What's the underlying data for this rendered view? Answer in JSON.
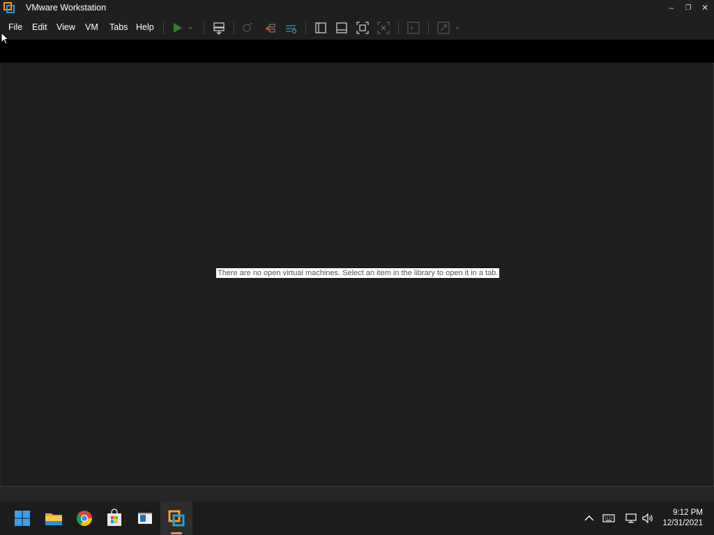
{
  "window": {
    "title": "VMware Workstation",
    "controls": {
      "minimize": "–",
      "maximize": "❐",
      "close": "✕"
    }
  },
  "menu": {
    "items": [
      {
        "label": "File"
      },
      {
        "label": "Edit"
      },
      {
        "label": "View"
      },
      {
        "label": "VM"
      },
      {
        "label": "Tabs"
      },
      {
        "label": "Help"
      }
    ]
  },
  "toolbar": {
    "icons": [
      "play-icon",
      "dropdown-arrow-icon",
      "send-ctrl-alt-del-icon",
      "snapshot-icon",
      "revert-snapshot-icon",
      "snapshot-manager-icon",
      "library-icon",
      "thumbnail-bar-icon",
      "full-screen-icon",
      "unity-icon",
      "console-view-icon",
      "stretch-guest-icon"
    ]
  },
  "main": {
    "empty_message": "There are no open virtual machines. Select an item in the library to open it in a tab."
  },
  "taskbar": {
    "apps": [
      "windows-start-icon",
      "file-explorer-icon",
      "chrome-icon",
      "microsoft-store-icon",
      "vmware-app-icon-2",
      "vmware-workstation-icon"
    ],
    "tray": [
      "chevron-up-icon",
      "keyboard-icon",
      "network-icon",
      "volume-icon"
    ],
    "time": "9:12 PM",
    "date": "12/31/2021"
  },
  "colors": {
    "accent_green": "#4caf50",
    "vmware_orange": "#f0a030",
    "vmware_blue": "#2a9fd6"
  }
}
